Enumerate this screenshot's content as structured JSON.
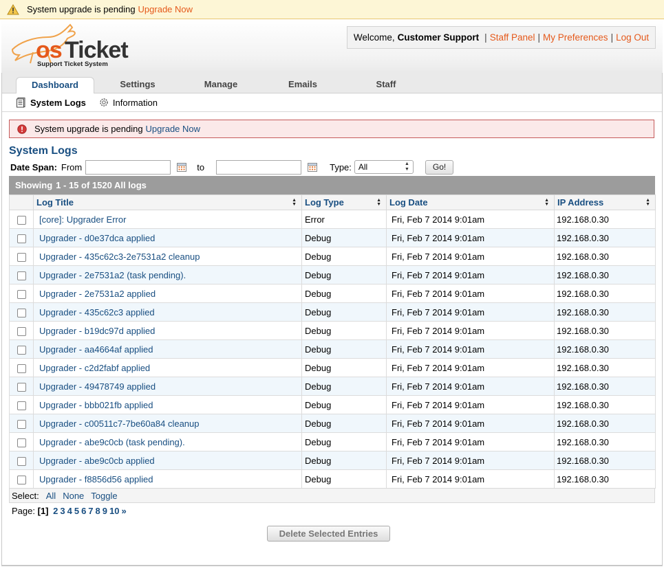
{
  "top_banner": {
    "icon": "warning-icon",
    "text": "System upgrade is pending",
    "link": "Upgrade Now"
  },
  "header": {
    "logo": {
      "text": "osTicket",
      "tagline": "Support Ticket System"
    },
    "welcome": "Welcome,",
    "user": "Customer Support",
    "links": [
      "Staff Panel",
      "My Preferences",
      "Log Out"
    ],
    "sep": "|"
  },
  "nav": {
    "tabs": [
      {
        "label": "Dashboard",
        "active": true
      },
      {
        "label": "Settings"
      },
      {
        "label": "Manage"
      },
      {
        "label": "Emails"
      },
      {
        "label": "Staff"
      }
    ]
  },
  "subnav": {
    "items": [
      {
        "label": "System Logs",
        "icon": "log-document-icon",
        "active": true
      },
      {
        "label": "Information",
        "icon": "gear-icon"
      }
    ]
  },
  "error_banner": {
    "icon": "error-icon",
    "text": "System upgrade is pending",
    "link": "Upgrade Now"
  },
  "page": {
    "title": "System Logs"
  },
  "filter": {
    "date_span_label": "Date Span:",
    "from_label": "From",
    "to_label": "to",
    "from_value": "",
    "to_value": "",
    "type_label": "Type:",
    "type_selected": "All",
    "go_label": "Go!"
  },
  "table": {
    "showing_label": "Showing",
    "showing_range": "1 - 15 of 1520 All logs",
    "columns": [
      "Log Title",
      "Log Type",
      "Log Date",
      "IP Address"
    ],
    "rows": [
      {
        "title": "[core]: Upgrader Error",
        "type": "Error",
        "date": "Fri, Feb 7 2014 9:01am",
        "ip": "192.168.0.30"
      },
      {
        "title": "Upgrader - d0e37dca applied",
        "type": "Debug",
        "date": "Fri, Feb 7 2014 9:01am",
        "ip": "192.168.0.30"
      },
      {
        "title": "Upgrader - 435c62c3-2e7531a2 cleanup",
        "type": "Debug",
        "date": "Fri, Feb 7 2014 9:01am",
        "ip": "192.168.0.30"
      },
      {
        "title": "Upgrader - 2e7531a2 (task pending).",
        "type": "Debug",
        "date": "Fri, Feb 7 2014 9:01am",
        "ip": "192.168.0.30"
      },
      {
        "title": "Upgrader - 2e7531a2 applied",
        "type": "Debug",
        "date": "Fri, Feb 7 2014 9:01am",
        "ip": "192.168.0.30"
      },
      {
        "title": "Upgrader - 435c62c3 applied",
        "type": "Debug",
        "date": "Fri, Feb 7 2014 9:01am",
        "ip": "192.168.0.30"
      },
      {
        "title": "Upgrader - b19dc97d applied",
        "type": "Debug",
        "date": "Fri, Feb 7 2014 9:01am",
        "ip": "192.168.0.30"
      },
      {
        "title": "Upgrader - aa4664af applied",
        "type": "Debug",
        "date": "Fri, Feb 7 2014 9:01am",
        "ip": "192.168.0.30"
      },
      {
        "title": "Upgrader - c2d2fabf applied",
        "type": "Debug",
        "date": "Fri, Feb 7 2014 9:01am",
        "ip": "192.168.0.30"
      },
      {
        "title": "Upgrader - 49478749 applied",
        "type": "Debug",
        "date": "Fri, Feb 7 2014 9:01am",
        "ip": "192.168.0.30"
      },
      {
        "title": "Upgrader - bbb021fb applied",
        "type": "Debug",
        "date": "Fri, Feb 7 2014 9:01am",
        "ip": "192.168.0.30"
      },
      {
        "title": "Upgrader - c00511c7-7be60a84 cleanup",
        "type": "Debug",
        "date": "Fri, Feb 7 2014 9:01am",
        "ip": "192.168.0.30"
      },
      {
        "title": "Upgrader - abe9c0cb (task pending).",
        "type": "Debug",
        "date": "Fri, Feb 7 2014 9:01am",
        "ip": "192.168.0.30"
      },
      {
        "title": "Upgrader - abe9c0cb applied",
        "type": "Debug",
        "date": "Fri, Feb 7 2014 9:01am",
        "ip": "192.168.0.30"
      },
      {
        "title": "Upgrader - f8856d56 applied",
        "type": "Debug",
        "date": "Fri, Feb 7 2014 9:01am",
        "ip": "192.168.0.30"
      }
    ],
    "select_label": "Select:",
    "select_links": [
      "All",
      "None",
      "Toggle"
    ]
  },
  "pager": {
    "label": "Page:",
    "current": "[1]",
    "pages": [
      "2",
      "3",
      "4",
      "5",
      "6",
      "7",
      "8",
      "9",
      "10",
      "»"
    ]
  },
  "actions": {
    "delete_label": "Delete Selected Entries"
  },
  "colors": {
    "link": "#184e81",
    "accent": "#e5591b",
    "warning_bg": "#fdf6d6",
    "error_bg": "#fbe9e9",
    "error_border": "#c55a5a",
    "table_header_bar": "#9c9c9c",
    "row_alt": "#f0f7fc"
  }
}
